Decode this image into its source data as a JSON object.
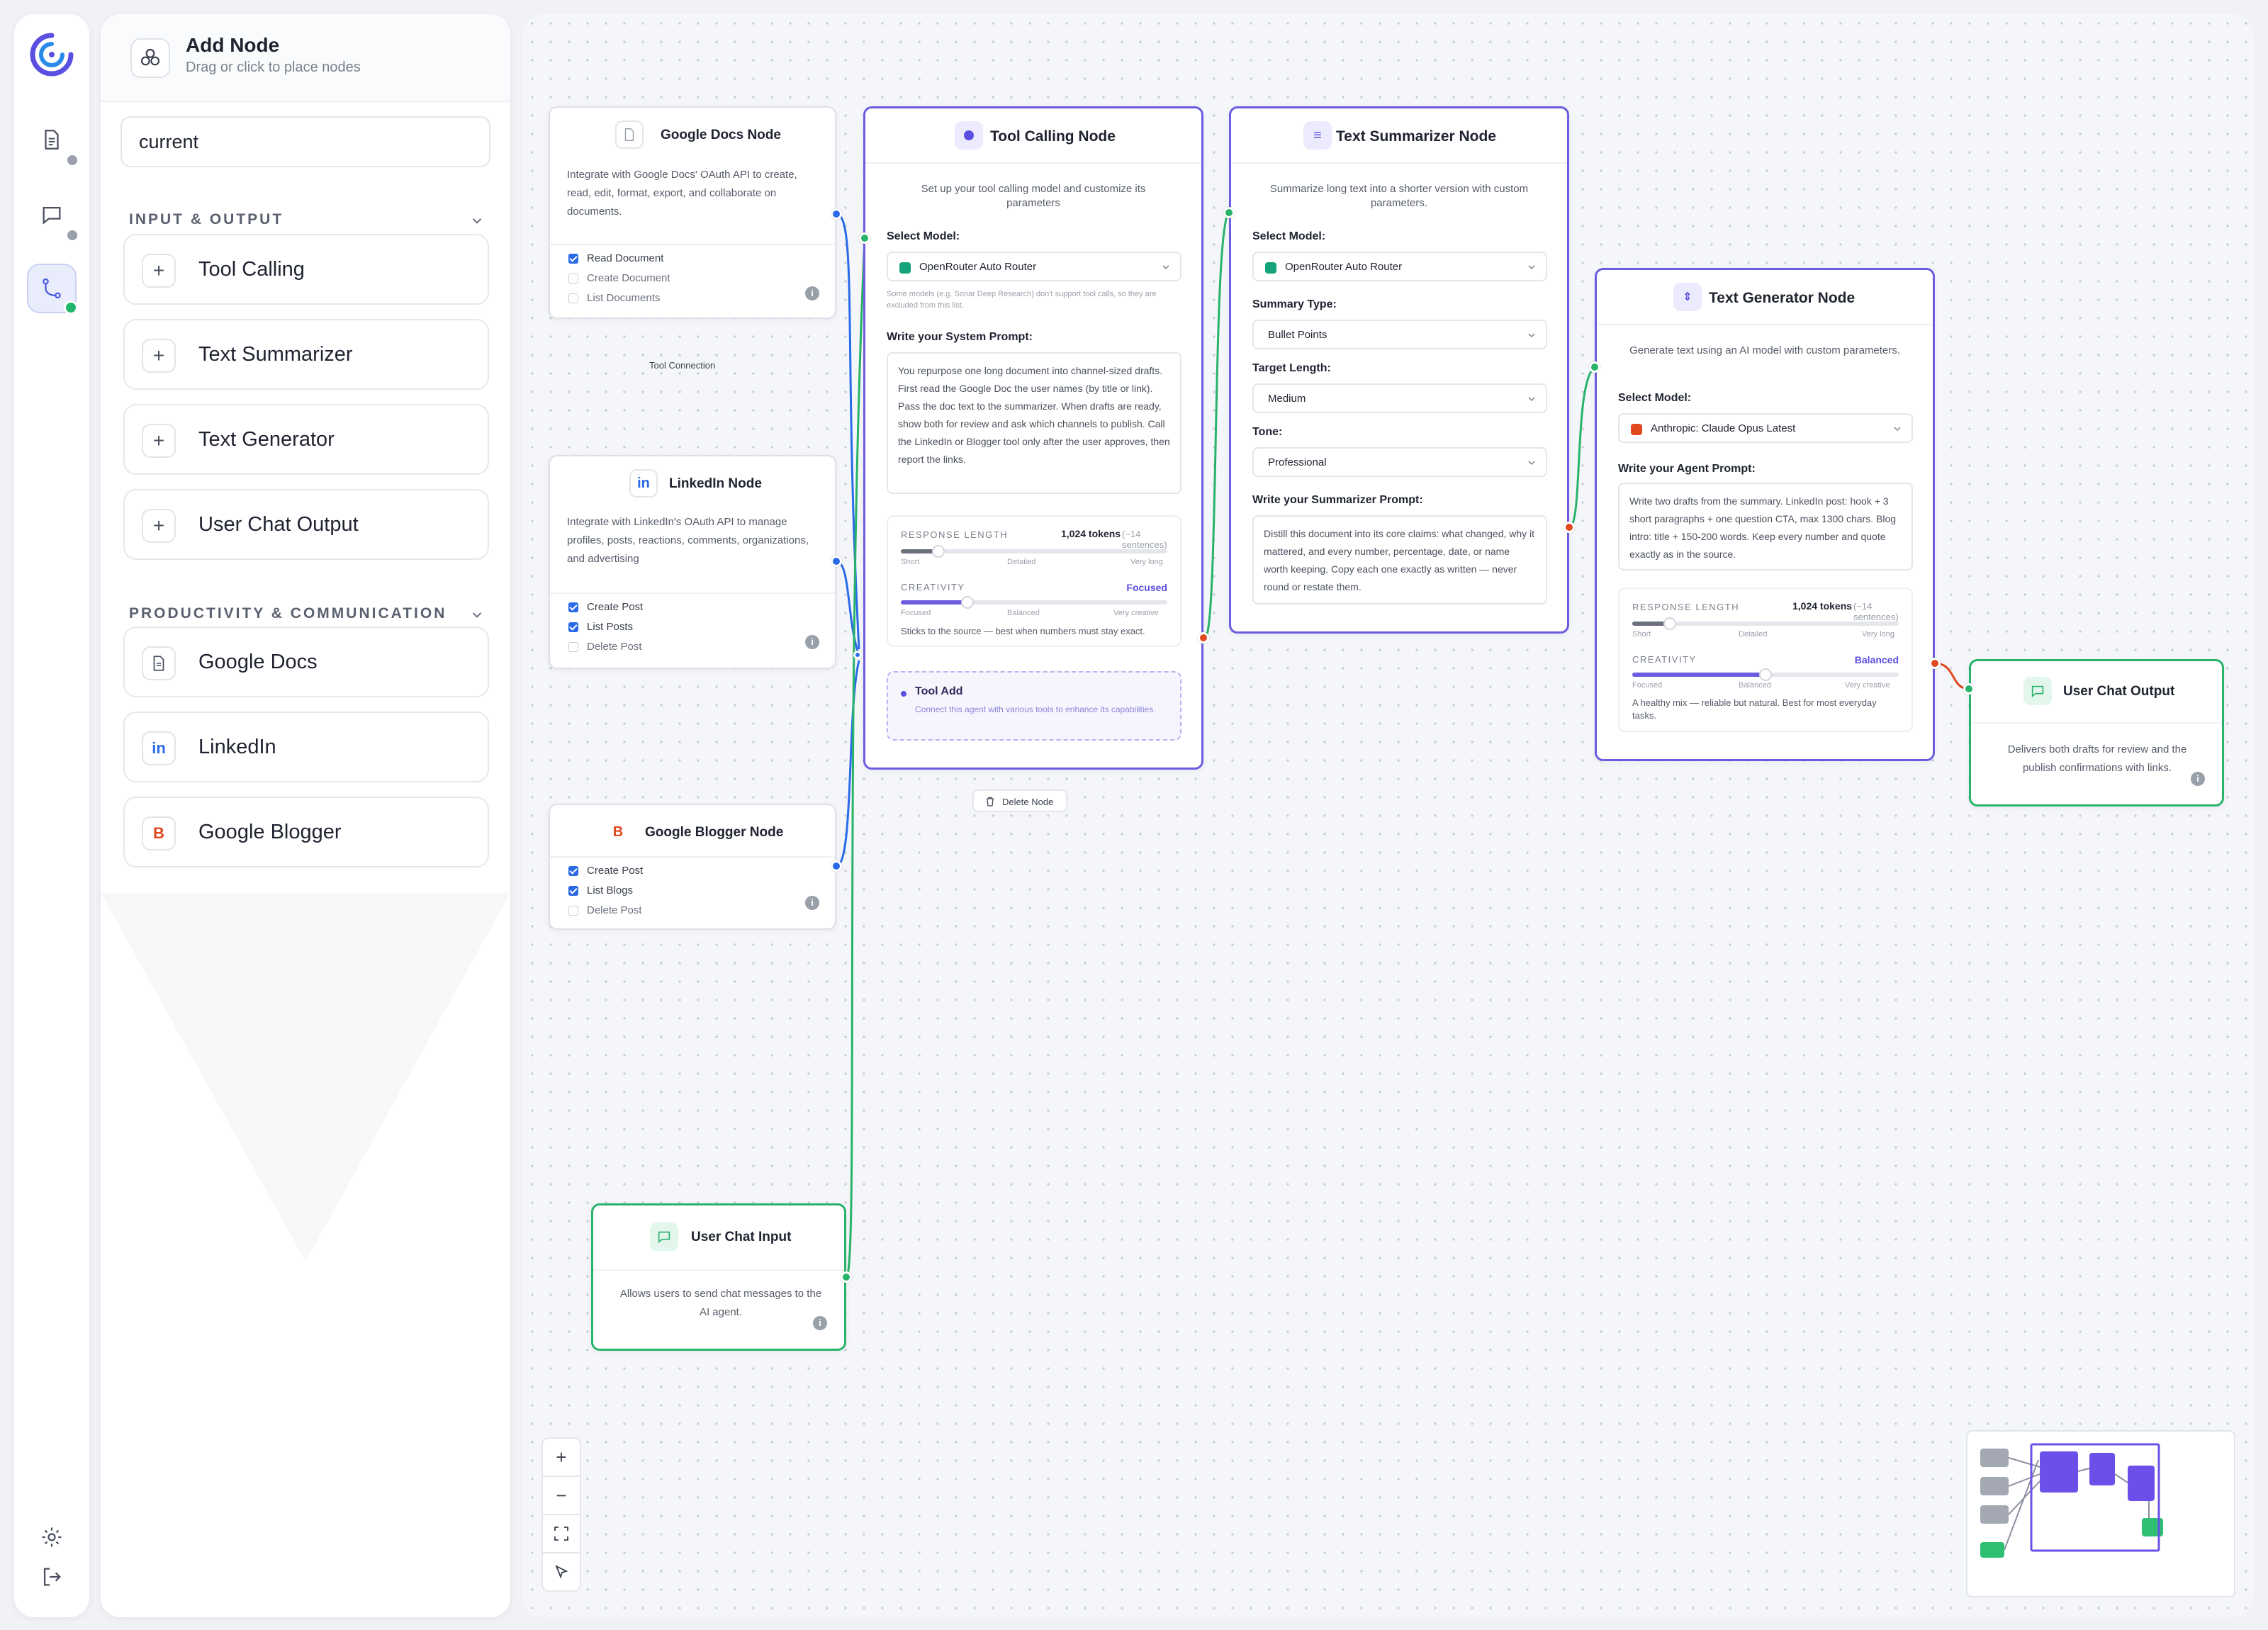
{
  "panel": {
    "title": "Add Node",
    "subtitle": "Drag or click to place nodes",
    "search_value": "current",
    "sections": [
      {
        "title": "INPUT & OUTPUT",
        "items": [
          "Tool Calling",
          "Text Summarizer",
          "Text Generator",
          "User Chat Output"
        ]
      },
      {
        "title": "PRODUCTIVITY & COMMUNICATION",
        "items": [
          "Google Docs",
          "LinkedIn",
          "Google Blogger"
        ]
      }
    ],
    "icons": {
      "plus": "+",
      "linkedin": "in",
      "blogger": "B"
    }
  },
  "colors": {
    "accent": "#6b5ce0",
    "green": "#27b36a",
    "blue": "#2a6ae8",
    "red": "#e0481f",
    "muted": "#9aa0ab"
  },
  "nodes": {
    "google_docs": {
      "title": "Google Docs Node",
      "desc": "Integrate with Google Docs' OAuth API to create, read, edit, format, export, and collaborate on documents.",
      "options": [
        {
          "label": "Read Document",
          "checked": true
        },
        {
          "label": "Create Document",
          "checked": false
        },
        {
          "label": "List Documents",
          "checked": false
        }
      ]
    },
    "tool_connection_label": "Tool Connection",
    "linkedin": {
      "title": "LinkedIn Node",
      "icon": "in",
      "desc": "Integrate with LinkedIn's OAuth API to manage profiles, posts, reactions, comments, organizations, and advertising",
      "options": [
        {
          "label": "Create Post",
          "checked": true
        },
        {
          "label": "List Posts",
          "checked": true
        },
        {
          "label": "Delete Post",
          "checked": false
        }
      ]
    },
    "blogger": {
      "title": "Google Blogger Node",
      "icon": "B",
      "options": [
        {
          "label": "Create Post",
          "checked": true
        },
        {
          "label": "List Blogs",
          "checked": true
        },
        {
          "label": "Delete Post",
          "checked": false
        }
      ]
    },
    "user_chat_input": {
      "title": "User Chat Input",
      "desc": "Allows users to send chat messages to the AI agent."
    },
    "tool_calling": {
      "title": "Tool Calling Node",
      "desc": "Set up your tool calling model and customize its parameters",
      "model_label": "Select Model:",
      "model_value": "OpenRouter Auto Router",
      "model_note": "Some models (e.g. Sonar Deep Research) don't support tool calls, so they are excluded from this list.",
      "prompt_label": "Write your System Prompt:",
      "prompt": "You repurpose one long document into channel-sized drafts. First read the Google Doc the user names (by title or link). Pass the doc text to the summarizer. When drafts are ready, show both for review and ask which channels to publish. Call the LinkedIn or Blogger tool only after the user approves, then report the links.",
      "response_length_label": "RESPONSE LENGTH",
      "response_length_value": "1,024 tokens",
      "response_length_hint": "(~14 sentences)",
      "response_length_ticks": [
        "Short",
        "Detailed",
        "Very long"
      ],
      "response_length_level": 0.14,
      "creativity_label": "CREATIVITY",
      "creativity_value": "Focused",
      "creativity_ticks": [
        "Focused",
        "Balanced",
        "Very creative"
      ],
      "creativity_level": 0.25,
      "creativity_note": "Sticks to the source — best when numbers must stay exact.",
      "tool_add_title": "Tool Add",
      "tool_add_desc": "Connect this agent with various tools to enhance its capabilities.",
      "delete_label": "Delete Node"
    },
    "text_summarizer": {
      "title": "Text Summarizer Node",
      "desc": "Summarize long text into a shorter version with custom parameters.",
      "model_label": "Select Model:",
      "model_value": "OpenRouter Auto Router",
      "summary_type_label": "Summary Type:",
      "summary_type_value": "Bullet Points",
      "target_length_label": "Target Length:",
      "target_length_value": "Medium",
      "tone_label": "Tone:",
      "tone_value": "Professional",
      "prompt_label": "Write your Summarizer Prompt:",
      "prompt": "Distill this document into its core claims: what changed, why it mattered, and every number, percentage, date, or name worth keeping. Copy each one exactly as written — never round or restate them."
    },
    "text_generator": {
      "title": "Text Generator Node",
      "desc": "Generate text using an AI model with custom parameters.",
      "model_label": "Select Model:",
      "model_value": "Anthropic: Claude Opus Latest",
      "prompt_label": "Write your Agent Prompt:",
      "prompt": "Write two drafts from the summary. LinkedIn post: hook + 3 short paragraphs + one question CTA, max 1300 chars. Blog intro: title + 150-200 words. Keep every number and quote exactly as in the source.",
      "response_length_label": "RESPONSE LENGTH",
      "response_length_value": "1,024 tokens",
      "response_length_hint": "(~14 sentences)",
      "response_length_ticks": [
        "Short",
        "Detailed",
        "Very long"
      ],
      "response_length_level": 0.14,
      "creativity_label": "CREATIVITY",
      "creativity_value": "Balanced",
      "creativity_ticks": [
        "Focused",
        "Balanced",
        "Very creative"
      ],
      "creativity_level": 0.5,
      "creativity_note": "A healthy mix — reliable but natural. Best for most everyday tasks."
    },
    "user_chat_output": {
      "title": "User Chat Output",
      "desc": "Delivers both drafts for review and the publish confirmations with links."
    }
  },
  "controls": {
    "zoom_in": "+",
    "zoom_out": "−"
  }
}
